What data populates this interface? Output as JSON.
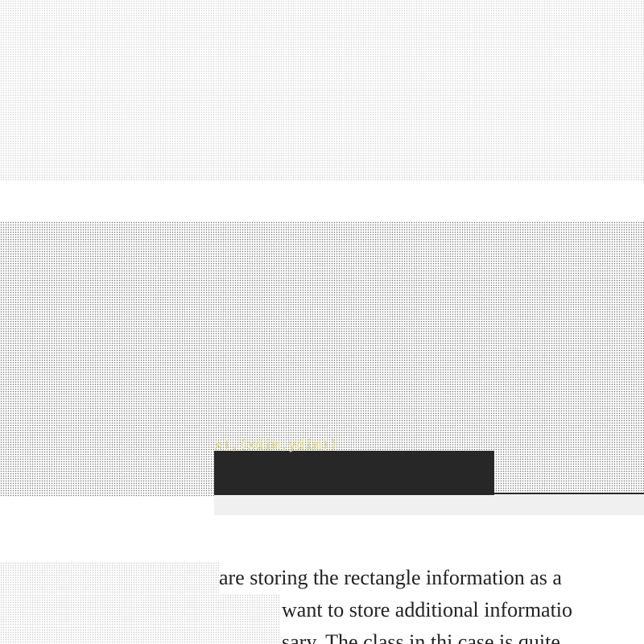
{
  "code_block": {
    "visible_fragment": "x),(xdim,ydim))"
  },
  "article": {
    "lines": [
      "are storing the rectangle information as a",
      "want to store additional informatio",
      "sary. The class in thi  case is quite"
    ]
  },
  "colors": {
    "code_background": "#272727",
    "code_footer": "#f0f0f0",
    "code_text": "#e6db74",
    "body_text": "#222222"
  }
}
